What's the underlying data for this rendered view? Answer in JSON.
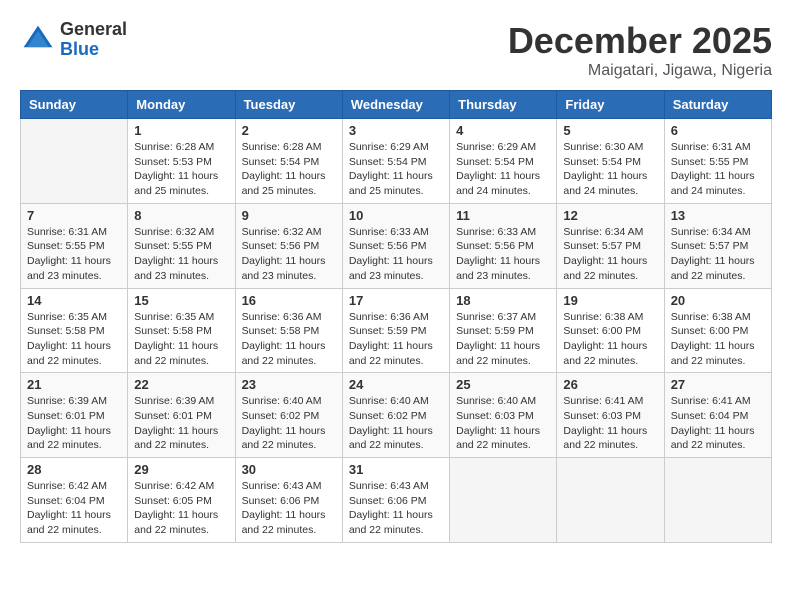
{
  "header": {
    "logo_general": "General",
    "logo_blue": "Blue",
    "month_title": "December 2025",
    "location": "Maigatari, Jigawa, Nigeria"
  },
  "days_of_week": [
    "Sunday",
    "Monday",
    "Tuesday",
    "Wednesday",
    "Thursday",
    "Friday",
    "Saturday"
  ],
  "weeks": [
    [
      {
        "day": "",
        "info": ""
      },
      {
        "day": "1",
        "info": "Sunrise: 6:28 AM\nSunset: 5:53 PM\nDaylight: 11 hours\nand 25 minutes."
      },
      {
        "day": "2",
        "info": "Sunrise: 6:28 AM\nSunset: 5:54 PM\nDaylight: 11 hours\nand 25 minutes."
      },
      {
        "day": "3",
        "info": "Sunrise: 6:29 AM\nSunset: 5:54 PM\nDaylight: 11 hours\nand 25 minutes."
      },
      {
        "day": "4",
        "info": "Sunrise: 6:29 AM\nSunset: 5:54 PM\nDaylight: 11 hours\nand 24 minutes."
      },
      {
        "day": "5",
        "info": "Sunrise: 6:30 AM\nSunset: 5:54 PM\nDaylight: 11 hours\nand 24 minutes."
      },
      {
        "day": "6",
        "info": "Sunrise: 6:31 AM\nSunset: 5:55 PM\nDaylight: 11 hours\nand 24 minutes."
      }
    ],
    [
      {
        "day": "7",
        "info": "Sunrise: 6:31 AM\nSunset: 5:55 PM\nDaylight: 11 hours\nand 23 minutes."
      },
      {
        "day": "8",
        "info": "Sunrise: 6:32 AM\nSunset: 5:55 PM\nDaylight: 11 hours\nand 23 minutes."
      },
      {
        "day": "9",
        "info": "Sunrise: 6:32 AM\nSunset: 5:56 PM\nDaylight: 11 hours\nand 23 minutes."
      },
      {
        "day": "10",
        "info": "Sunrise: 6:33 AM\nSunset: 5:56 PM\nDaylight: 11 hours\nand 23 minutes."
      },
      {
        "day": "11",
        "info": "Sunrise: 6:33 AM\nSunset: 5:56 PM\nDaylight: 11 hours\nand 23 minutes."
      },
      {
        "day": "12",
        "info": "Sunrise: 6:34 AM\nSunset: 5:57 PM\nDaylight: 11 hours\nand 22 minutes."
      },
      {
        "day": "13",
        "info": "Sunrise: 6:34 AM\nSunset: 5:57 PM\nDaylight: 11 hours\nand 22 minutes."
      }
    ],
    [
      {
        "day": "14",
        "info": "Sunrise: 6:35 AM\nSunset: 5:58 PM\nDaylight: 11 hours\nand 22 minutes."
      },
      {
        "day": "15",
        "info": "Sunrise: 6:35 AM\nSunset: 5:58 PM\nDaylight: 11 hours\nand 22 minutes."
      },
      {
        "day": "16",
        "info": "Sunrise: 6:36 AM\nSunset: 5:58 PM\nDaylight: 11 hours\nand 22 minutes."
      },
      {
        "day": "17",
        "info": "Sunrise: 6:36 AM\nSunset: 5:59 PM\nDaylight: 11 hours\nand 22 minutes."
      },
      {
        "day": "18",
        "info": "Sunrise: 6:37 AM\nSunset: 5:59 PM\nDaylight: 11 hours\nand 22 minutes."
      },
      {
        "day": "19",
        "info": "Sunrise: 6:38 AM\nSunset: 6:00 PM\nDaylight: 11 hours\nand 22 minutes."
      },
      {
        "day": "20",
        "info": "Sunrise: 6:38 AM\nSunset: 6:00 PM\nDaylight: 11 hours\nand 22 minutes."
      }
    ],
    [
      {
        "day": "21",
        "info": "Sunrise: 6:39 AM\nSunset: 6:01 PM\nDaylight: 11 hours\nand 22 minutes."
      },
      {
        "day": "22",
        "info": "Sunrise: 6:39 AM\nSunset: 6:01 PM\nDaylight: 11 hours\nand 22 minutes."
      },
      {
        "day": "23",
        "info": "Sunrise: 6:40 AM\nSunset: 6:02 PM\nDaylight: 11 hours\nand 22 minutes."
      },
      {
        "day": "24",
        "info": "Sunrise: 6:40 AM\nSunset: 6:02 PM\nDaylight: 11 hours\nand 22 minutes."
      },
      {
        "day": "25",
        "info": "Sunrise: 6:40 AM\nSunset: 6:03 PM\nDaylight: 11 hours\nand 22 minutes."
      },
      {
        "day": "26",
        "info": "Sunrise: 6:41 AM\nSunset: 6:03 PM\nDaylight: 11 hours\nand 22 minutes."
      },
      {
        "day": "27",
        "info": "Sunrise: 6:41 AM\nSunset: 6:04 PM\nDaylight: 11 hours\nand 22 minutes."
      }
    ],
    [
      {
        "day": "28",
        "info": "Sunrise: 6:42 AM\nSunset: 6:04 PM\nDaylight: 11 hours\nand 22 minutes."
      },
      {
        "day": "29",
        "info": "Sunrise: 6:42 AM\nSunset: 6:05 PM\nDaylight: 11 hours\nand 22 minutes."
      },
      {
        "day": "30",
        "info": "Sunrise: 6:43 AM\nSunset: 6:06 PM\nDaylight: 11 hours\nand 22 minutes."
      },
      {
        "day": "31",
        "info": "Sunrise: 6:43 AM\nSunset: 6:06 PM\nDaylight: 11 hours\nand 22 minutes."
      },
      {
        "day": "",
        "info": ""
      },
      {
        "day": "",
        "info": ""
      },
      {
        "day": "",
        "info": ""
      }
    ]
  ]
}
